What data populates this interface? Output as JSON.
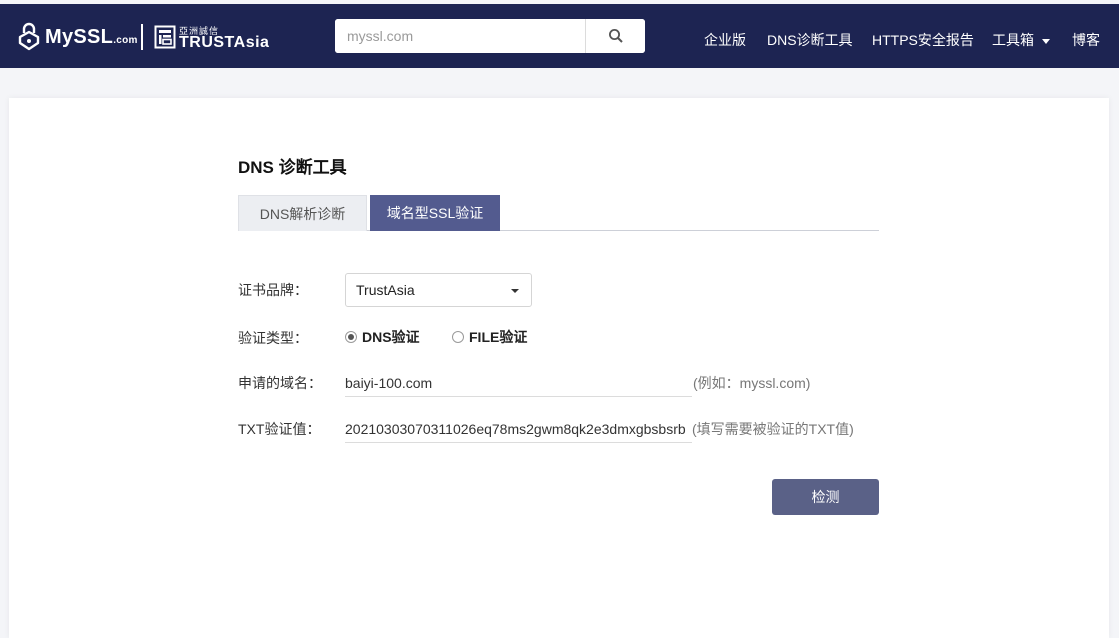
{
  "header": {
    "logo_text": "MySSL",
    "logo_suffix": ".com",
    "partner_cn": "亞洲誠信",
    "partner_en": "TRUSTAsia",
    "search_placeholder": "myssl.com",
    "nav": [
      {
        "label": "企业版"
      },
      {
        "label": "DNS诊断工具"
      },
      {
        "label": "HTTPS安全报告"
      },
      {
        "label": "工具箱"
      },
      {
        "label": "博客"
      }
    ]
  },
  "main": {
    "title": "DNS 诊断工具",
    "tabs": [
      {
        "label": "DNS解析诊断",
        "active": false
      },
      {
        "label": "域名型SSL验证",
        "active": true
      }
    ],
    "form": {
      "brand_label": "证书品牌：",
      "brand_value": "TrustAsia",
      "type_label": "验证类型：",
      "type_options": [
        {
          "label": "DNS验证",
          "checked": true
        },
        {
          "label": "FILE验证",
          "checked": false
        }
      ],
      "domain_label": "申请的域名：",
      "domain_value": "baiyi-100.com",
      "domain_hint": "(例如：myssl.com)",
      "txt_label": "TXT验证值：",
      "txt_value": "20210303070311026eq78ms2gwm8qk2e3dmxgbsbsrb",
      "txt_hint": "(填写需要被验证的TXT值)",
      "submit_label": "检测"
    }
  },
  "colors": {
    "nav_bg": "#1d2452",
    "tab_active": "#535b8f",
    "button_bg": "#5a6187"
  }
}
